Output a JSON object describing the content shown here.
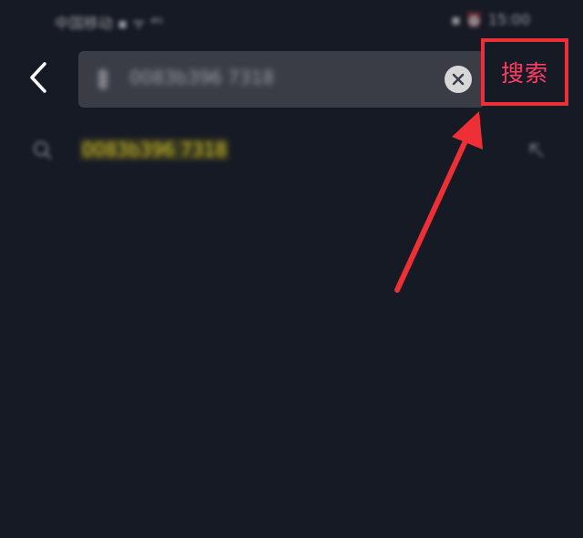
{
  "status_bar": {
    "left_text": "中国移动 ▪ ᯤ ⁴ᴳ",
    "right_text": "▪ ⏰ 15:00"
  },
  "search": {
    "query_value": "0083b396 7318",
    "action_label": "搜索"
  },
  "suggestions": [
    {
      "text": "0083b396 7318"
    }
  ],
  "colors": {
    "background": "#161a25",
    "search_box": "#3a3d46",
    "accent_label": "#ff3d64",
    "annotation_red": "#ee2f35",
    "highlight": "#cfc42a"
  },
  "icons": {
    "back": "chevron-left-icon",
    "clear": "close-icon",
    "suggestion": "search-icon",
    "fill": "arrow-up-left-icon"
  }
}
